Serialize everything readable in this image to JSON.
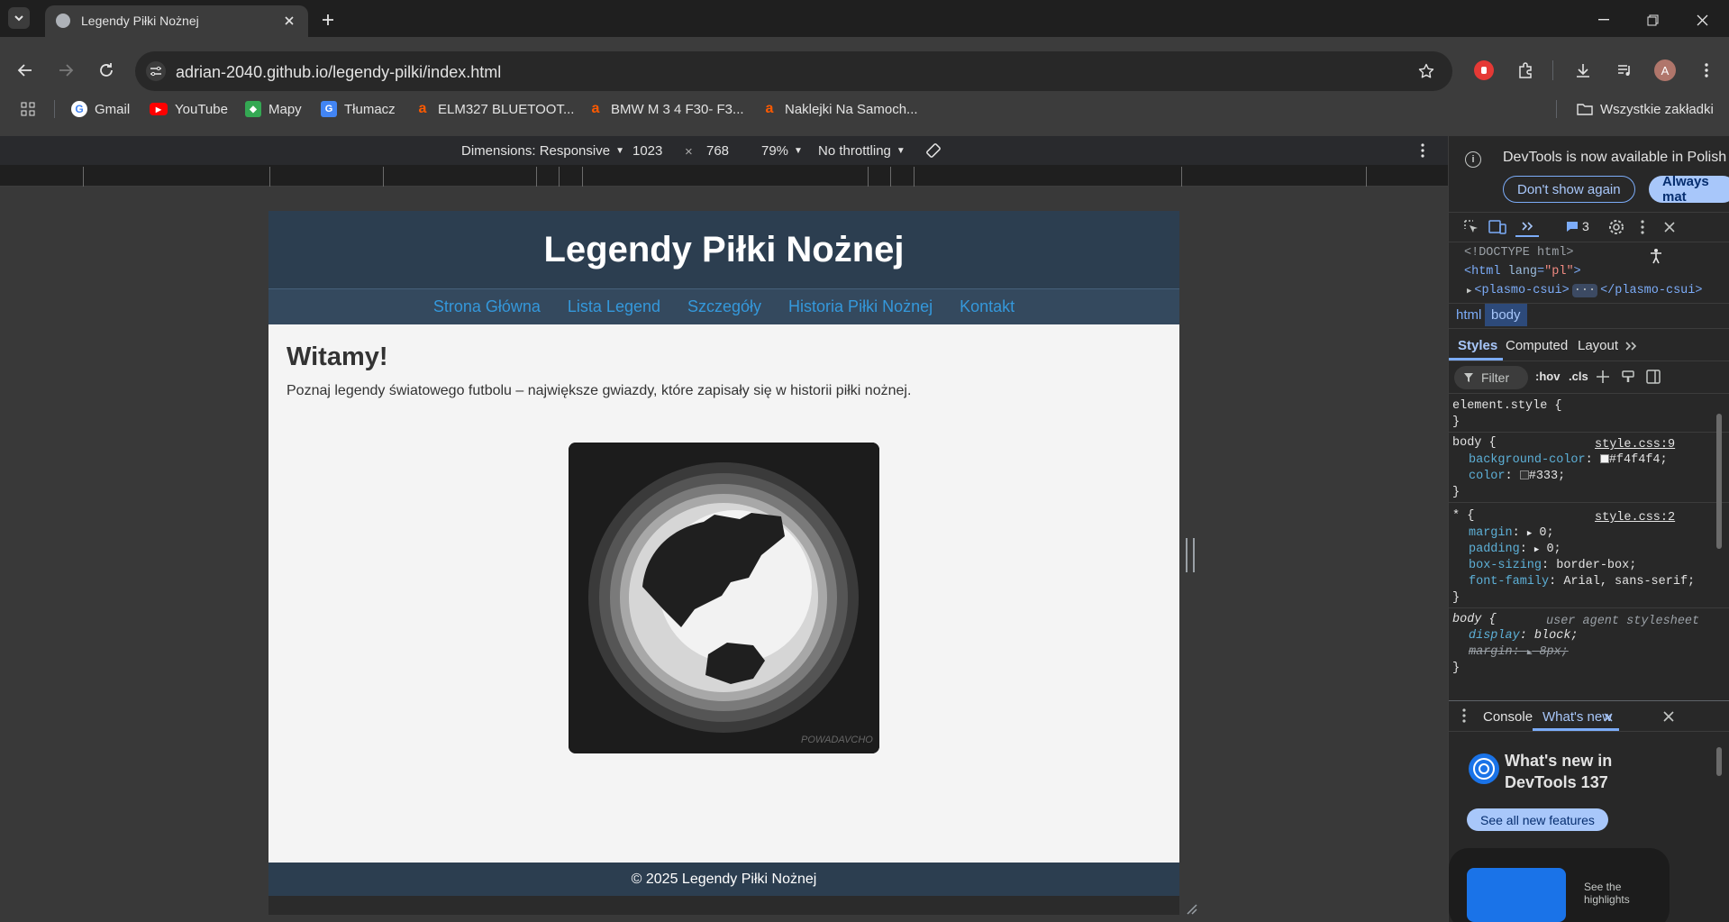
{
  "browser": {
    "tab_title": "Legendy Piłki Nożnej",
    "url": "adrian-2040.github.io/legendy-pilki/index.html",
    "profile_initial": "A",
    "bookmarks": [
      {
        "label": "Gmail",
        "icon": "gmail-icon"
      },
      {
        "label": "YouTube",
        "icon": "youtube-icon"
      },
      {
        "label": "Mapy",
        "icon": "maps-icon"
      },
      {
        "label": "Tłumacz",
        "icon": "translate-icon"
      },
      {
        "label": "ELM327 BLUETOOT...",
        "icon": "allegro-icon"
      },
      {
        "label": "BMW M 3 4 F30- F3...",
        "icon": "allegro-icon"
      },
      {
        "label": "Naklejki Na Samoch...",
        "icon": "allegro-icon"
      }
    ],
    "all_bookmarks": "Wszystkie zakładki"
  },
  "device_toolbar": {
    "dimensions": "Dimensions: Responsive",
    "width": "1023",
    "times": "×",
    "height": "768",
    "zoom": "79%",
    "throttling": "No throttling"
  },
  "page": {
    "title": "Legendy Piłki Nożnej",
    "nav": [
      "Strona Główna",
      "Lista Legend",
      "Szczegóły",
      "Historia Piłki Nożnej",
      "Kontakt"
    ],
    "heading": "Witamy!",
    "intro": "Poznaj legendy światowego futbolu – największe gwiazdy, które zapisały się w historii piłki nożnej.",
    "image_signature": "POWADAVCHO",
    "footer": "© 2025 Legendy Piłki Nożnej"
  },
  "devtools": {
    "banner_text": "DevTools is now available in Polish",
    "dont_show": "Don't show again",
    "always_match": "Always mat",
    "issues_count": "3",
    "dom": {
      "doctype": "<!DOCTYPE html>",
      "html_open_tag": "html",
      "html_attr_name": "lang",
      "html_attr_value": "\"pl\"",
      "plasmo_open": "<plasmo-csui>",
      "plasmo_ellipsis": "···",
      "plasmo_close": "</plasmo-csui>"
    },
    "breadcrumbs": [
      "html",
      "body"
    ],
    "style_tabs": [
      "Styles",
      "Computed",
      "Layout"
    ],
    "filter_placeholder": "Filter",
    "hov": ":hov",
    "cls": ".cls",
    "rules": {
      "element_style": "element.style {",
      "close": "}",
      "body_selector": "body {",
      "body_source": "style.css:9",
      "bg_prop": "background-color",
      "bg_val": "#f4f4f4;",
      "color_prop": "color",
      "color_val": "#333;",
      "star_selector": "* {",
      "star_source": "style.css:2",
      "margin_prop": "margin",
      "margin_val": "0;",
      "padding_prop": "padding",
      "padding_val": "0;",
      "boxsizing_prop": "box-sizing",
      "boxsizing_val": "border-box;",
      "fontfamily_prop": "font-family",
      "fontfamily_val": "Arial, sans-serif;",
      "ua_selector": "body {",
      "ua_source": "user agent stylesheet",
      "display_prop": "display",
      "display_val": "block;",
      "ua_margin_prop": "margin",
      "ua_margin_val": "8px;"
    },
    "drawer_tabs": [
      "Console",
      "What's new"
    ],
    "whats_new_title": "What's new in DevTools 137",
    "see_all": "See all new features",
    "highlight_text": "See the highlights"
  },
  "colors": {
    "page_header": "#2c3e50",
    "page_nav": "#34495e",
    "nav_link": "#3498db",
    "page_bg": "#f4f4f4",
    "accent_blue": "#a8c7fa"
  }
}
